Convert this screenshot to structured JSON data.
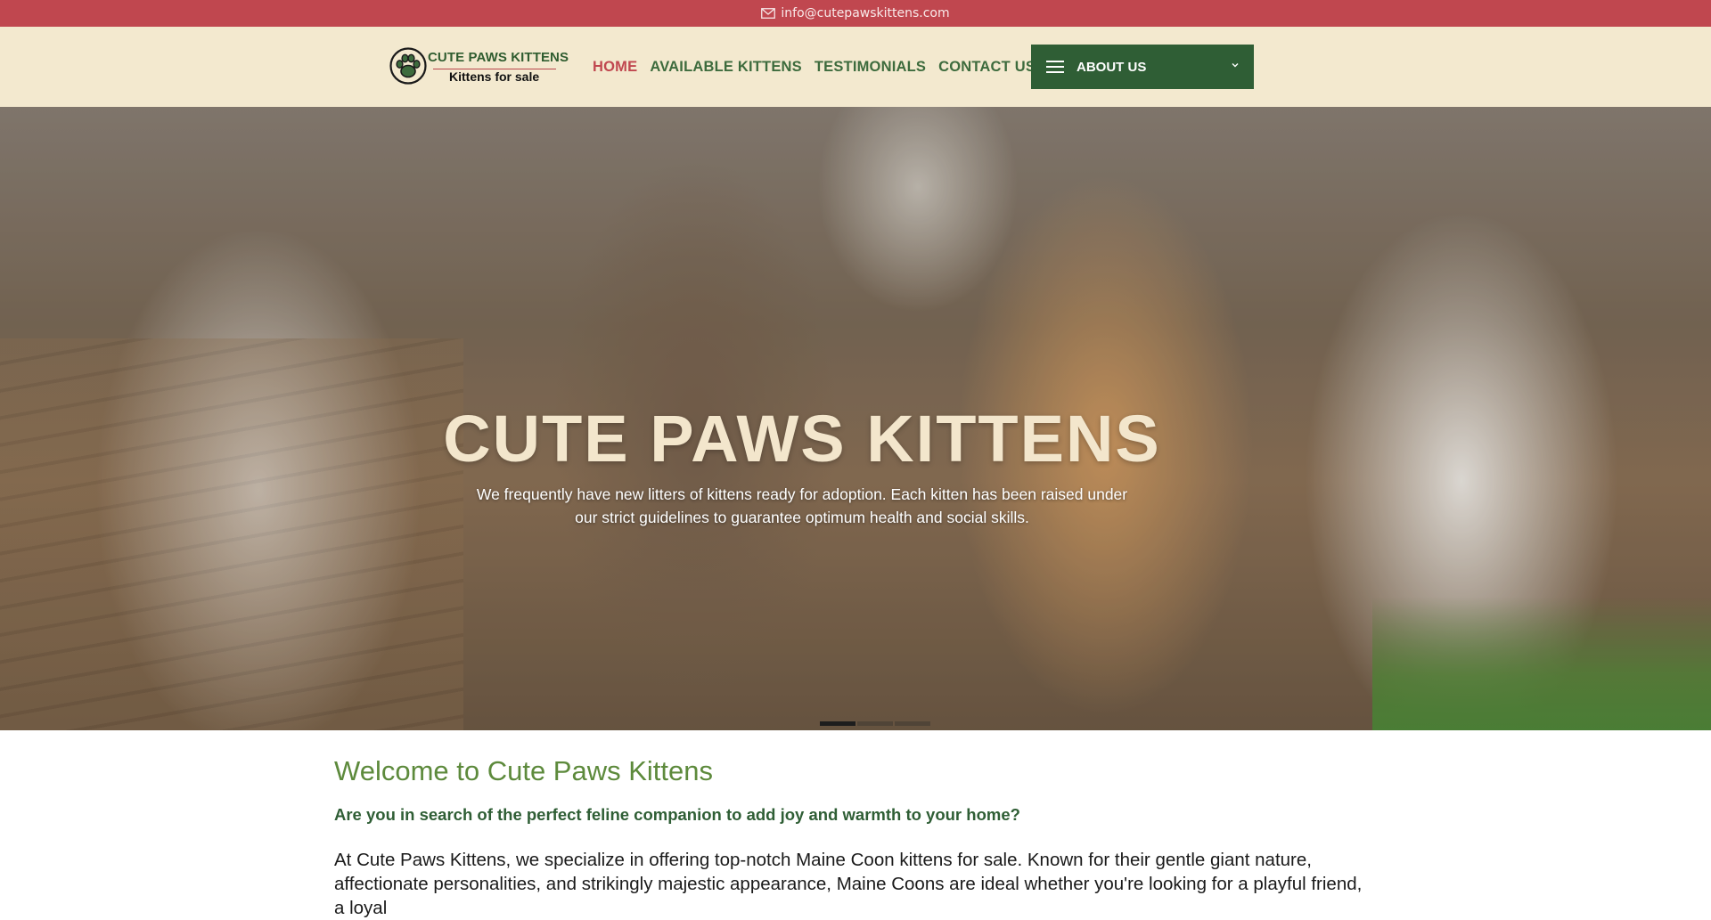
{
  "topbar": {
    "email": "info@cutepawskittens.com",
    "icon": "envelope-icon",
    "bg_color": "#c0474f"
  },
  "header": {
    "logo": {
      "brand": "CUTE PAWS KITTENS",
      "tagline": "Kittens for sale",
      "icon": "paw-icon"
    },
    "nav": [
      {
        "label": "HOME",
        "active": true
      },
      {
        "label": "AVAILABLE KITTENS",
        "active": false
      },
      {
        "label": "TESTIMONIALS",
        "active": false
      },
      {
        "label": "CONTACT US",
        "active": false
      }
    ],
    "about_button": {
      "label": "ABOUT US",
      "icon": "hamburger-menu-icon",
      "chevron": "chevron-down-icon",
      "bg_color": "#2f5e35"
    },
    "bg_color": "#f3e9cf"
  },
  "hero": {
    "title": "CUTE PAWS KITTENS",
    "subtitle": "We frequently have new litters of kittens ready for adoption. Each kitten has been raised under our strict guidelines to guarantee optimum health and social skills.",
    "slides": 3,
    "active_slide": 1
  },
  "main": {
    "heading": "Welcome to Cute Paws Kittens",
    "lead": "Are you in search of the perfect feline companion to add joy and warmth to your home?",
    "paragraph": "At Cute Paws Kittens, we specialize in offering top-notch Maine Coon kittens for sale. Known for their gentle giant nature, affectionate personalities, and strikingly majestic appearance, Maine Coons are ideal whether you're looking for a playful friend, a loyal"
  },
  "colors": {
    "accent_red": "#c0474f",
    "accent_green": "#2f5e35",
    "heading_green": "#5d8a3c",
    "hero_title": "#f3e6cc"
  }
}
